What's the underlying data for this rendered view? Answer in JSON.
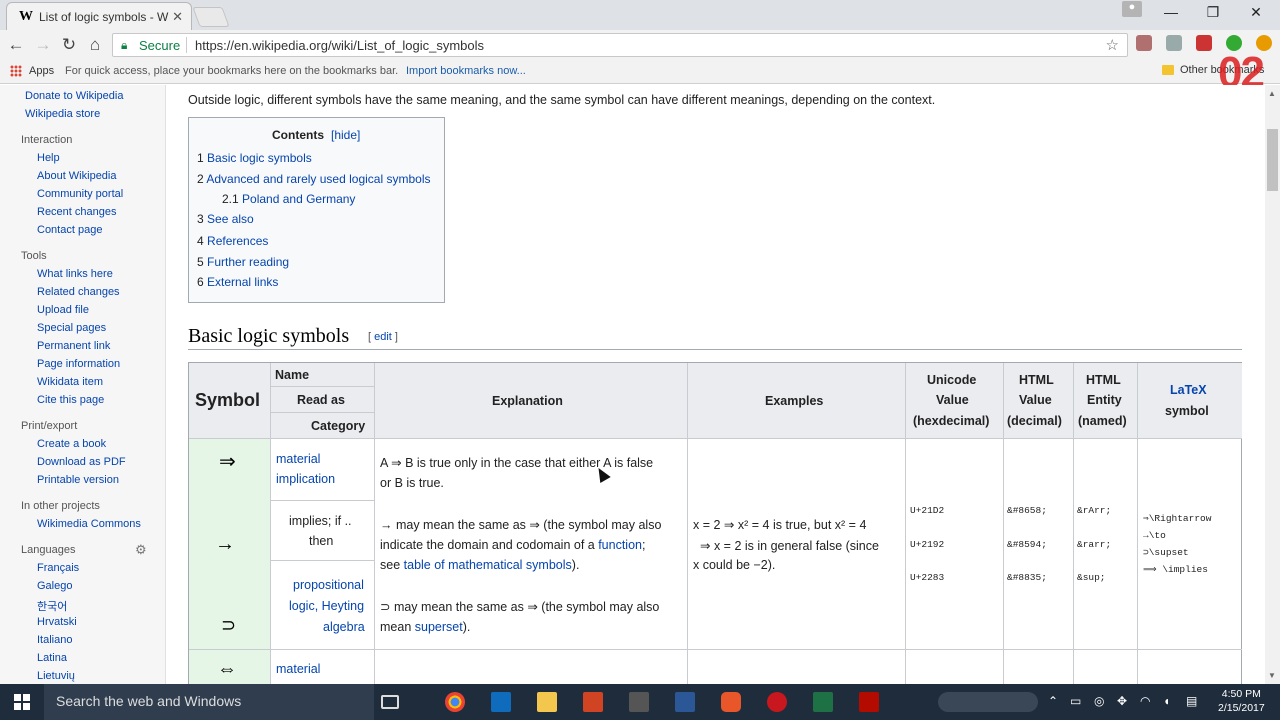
{
  "browser": {
    "tab_title": "List of logic symbols - W",
    "tab_favicon": "W",
    "secure_label": "Secure",
    "url": "https://en.wikipedia.org/wiki/List_of_logic_symbols",
    "bookmarks": {
      "apps": "Apps",
      "hint": "For quick access, place your bookmarks here on the bookmarks bar.",
      "import": "Import bookmarks now...",
      "other": "Other bookmarks"
    },
    "overlay": "02"
  },
  "sidebar": {
    "top_links": [
      "Donate to Wikipedia",
      "Wikipedia store"
    ],
    "interaction": {
      "heading": "Interaction",
      "items": [
        "Help",
        "About Wikipedia",
        "Community portal",
        "Recent changes",
        "Contact page"
      ]
    },
    "tools": {
      "heading": "Tools",
      "items": [
        "What links here",
        "Related changes",
        "Upload file",
        "Special pages",
        "Permanent link",
        "Page information",
        "Wikidata item",
        "Cite this page"
      ]
    },
    "print": {
      "heading": "Print/export",
      "items": [
        "Create a book",
        "Download as PDF",
        "Printable version"
      ]
    },
    "projects": {
      "heading": "In other projects",
      "items": [
        "Wikimedia Commons"
      ]
    },
    "languages": {
      "heading": "Languages",
      "items": [
        "Français",
        "Galego",
        "한국어",
        "Hrvatski",
        "Italiano",
        "Latina",
        "Lietuvių"
      ]
    }
  },
  "article": {
    "intro": "Outside logic, different symbols have the same meaning, and the same symbol can have different meanings, depending on the context.",
    "toc": {
      "title": "Contents",
      "hide": "[hide]",
      "items": [
        {
          "num": "1",
          "text": "Basic logic symbols"
        },
        {
          "num": "2",
          "text": "Advanced and rarely used logical symbols"
        },
        {
          "num": "2.1",
          "text": "Poland and Germany"
        },
        {
          "num": "3",
          "text": "See also"
        },
        {
          "num": "4",
          "text": "References"
        },
        {
          "num": "5",
          "text": "Further reading"
        },
        {
          "num": "6",
          "text": "External links"
        }
      ]
    },
    "section_title": "Basic logic symbols",
    "edit_open": "[ ",
    "edit": "edit",
    "edit_close": " ]"
  },
  "table": {
    "headers": {
      "symbol": "Symbol",
      "name": "Name",
      "read_as": "Read as",
      "category": "Category",
      "explanation": "Explanation",
      "examples": "Examples",
      "unicode": [
        "Unicode",
        "Value",
        "(hexdecimal)"
      ],
      "html_value": [
        "HTML",
        "Value",
        "(decimal)"
      ],
      "html_entity": [
        "HTML",
        "Entity",
        "(named)"
      ],
      "latex": [
        "LaTeX",
        "symbol"
      ]
    },
    "row1": {
      "symbols": [
        "⇒",
        "→",
        "⊃"
      ],
      "name": [
        "material",
        "implication"
      ],
      "read_as": [
        "implies; if ..",
        "then"
      ],
      "category": [
        "propositional",
        "logic, Heyting",
        "algebra"
      ],
      "expl1": [
        "A ⇒ B is true only in the case that either A is false",
        "or B is true."
      ],
      "expl2_pre": [
        "→ may mean the same as ⇒ (the symbol may also",
        "indicate the domain and codomain of a "
      ],
      "expl2_link1": "function",
      "expl2_mid": ";",
      "expl2_see": "see ",
      "expl2_link2": "table of mathematical symbols",
      "expl2_end": ").",
      "expl3_line1": "⊃ may mean the same as ⇒ (the symbol may also",
      "expl3_pre": "mean ",
      "expl3_link": "superset",
      "expl3_end": ").",
      "example": [
        "x = 2  ⇒  x² = 4 is true, but x² = 4",
        "⇒  x = 2 is in general false (since",
        "x could be −2)."
      ],
      "unicode": [
        "U+21D2",
        "U+2192",
        "U+2283"
      ],
      "html_value": [
        "&#8658;",
        "&#8594;",
        "&#8835;"
      ],
      "html_entity": [
        "&rArr;",
        "&rarr;",
        "&sup;"
      ],
      "latex": [
        "⇒\\Rightarrow",
        "→\\to",
        "⊃\\supset",
        "⟹ \\implies"
      ]
    },
    "row2": {
      "symbol": "⇔",
      "name": "material"
    }
  },
  "taskbar": {
    "search": "Search the web and Windows",
    "time": "4:50 PM",
    "date": "2/15/2017"
  }
}
